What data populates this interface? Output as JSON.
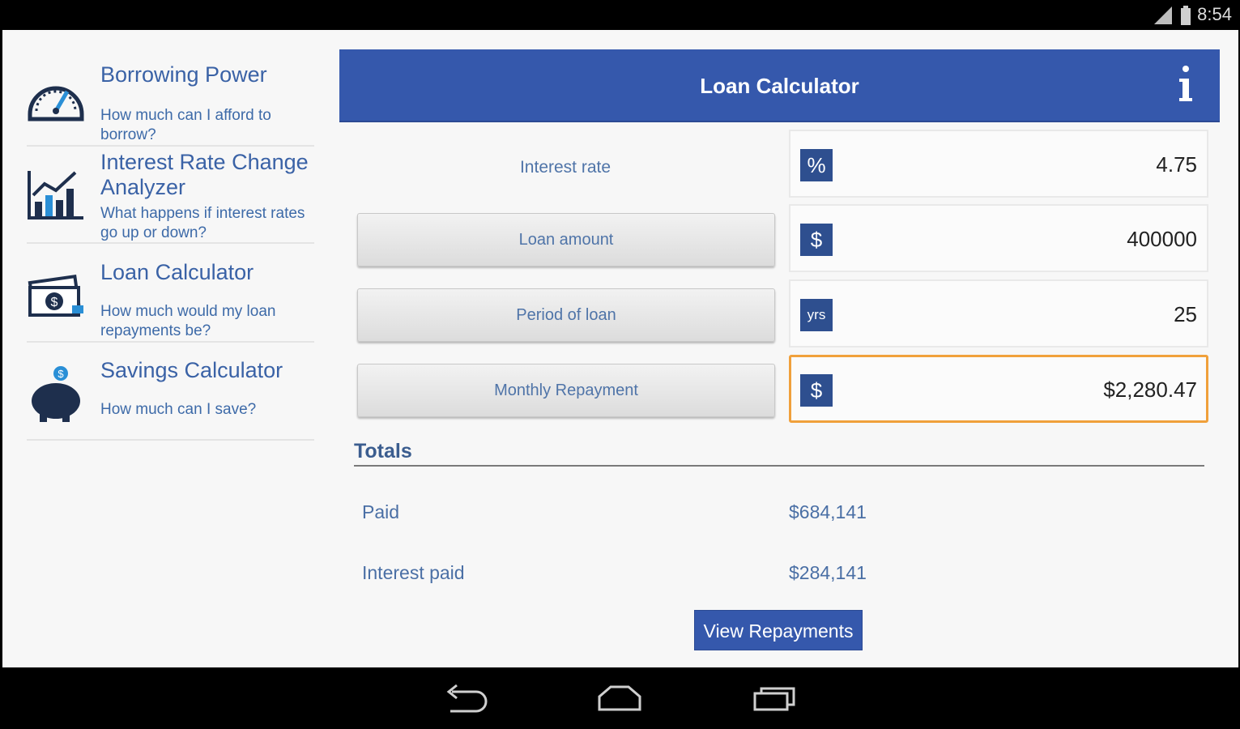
{
  "status_bar": {
    "time": "8:54"
  },
  "sidebar": {
    "items": [
      {
        "title": "Borrowing Power",
        "desc": "How much can I afford to borrow?",
        "icon": "speedometer-icon"
      },
      {
        "title": "Interest Rate Change Analyzer",
        "desc": "What happens if interest rates go up or down?",
        "icon": "chart-icon"
      },
      {
        "title": "Loan Calculator",
        "desc": "How much would my loan repayments be?",
        "icon": "money-icon"
      },
      {
        "title": "Savings Calculator",
        "desc": "How much can I save?",
        "icon": "piggy-bank-icon"
      }
    ]
  },
  "header": {
    "title": "Loan Calculator",
    "info_icon": "info-icon"
  },
  "calculator": {
    "rows": [
      {
        "label": "Interest rate",
        "unit": "%",
        "value": "4.75"
      },
      {
        "label": "Loan amount",
        "unit": "$",
        "value": "400000"
      },
      {
        "label": "Period of loan",
        "unit": "yrs",
        "value": "25"
      },
      {
        "label": "Monthly Repayment",
        "unit": "$",
        "value": "$2,280.47"
      }
    ]
  },
  "totals": {
    "title": "Totals",
    "paid_label": "Paid",
    "paid_value": "$684,141",
    "interest_label": "Interest paid",
    "interest_value": "$284,141"
  },
  "view_button": "View Repayments",
  "colors": {
    "accent": "#3558ac",
    "highlight": "#f0a03b",
    "text": "#4a6fa5"
  }
}
